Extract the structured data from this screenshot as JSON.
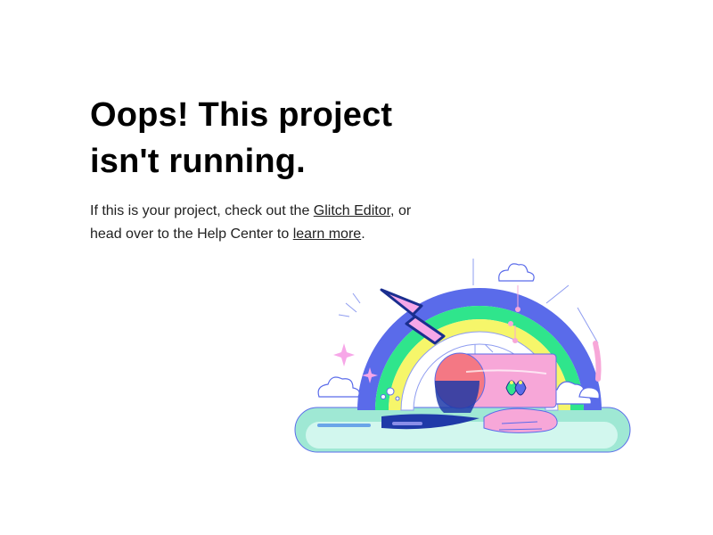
{
  "heading": {
    "line1": "Oops! This project",
    "line2": "isn't running."
  },
  "message": {
    "part1": "If this is your project, check out the ",
    "editor_link": "Glitch Editor",
    "part2": ", or",
    "part3": "head over to the Help Center to ",
    "learn_more_link": "learn more",
    "part4": "."
  },
  "illustration": {
    "icon": "broken-rainbow-illustration",
    "colors": {
      "arc_outer": "#5a6bea",
      "arc_green": "#2fe58c",
      "arc_yellow": "#f6f66a",
      "arc_inner": "#ffffff",
      "bolt_pink": "#f7a7e8",
      "bolt_navy": "#1a2e8f",
      "pipe_pink": "#f7a7d8",
      "pipe_red": "#f47884",
      "water": "#9fe8d4",
      "water_light": "#d2f7ee",
      "navy": "#1f3aa8"
    }
  }
}
